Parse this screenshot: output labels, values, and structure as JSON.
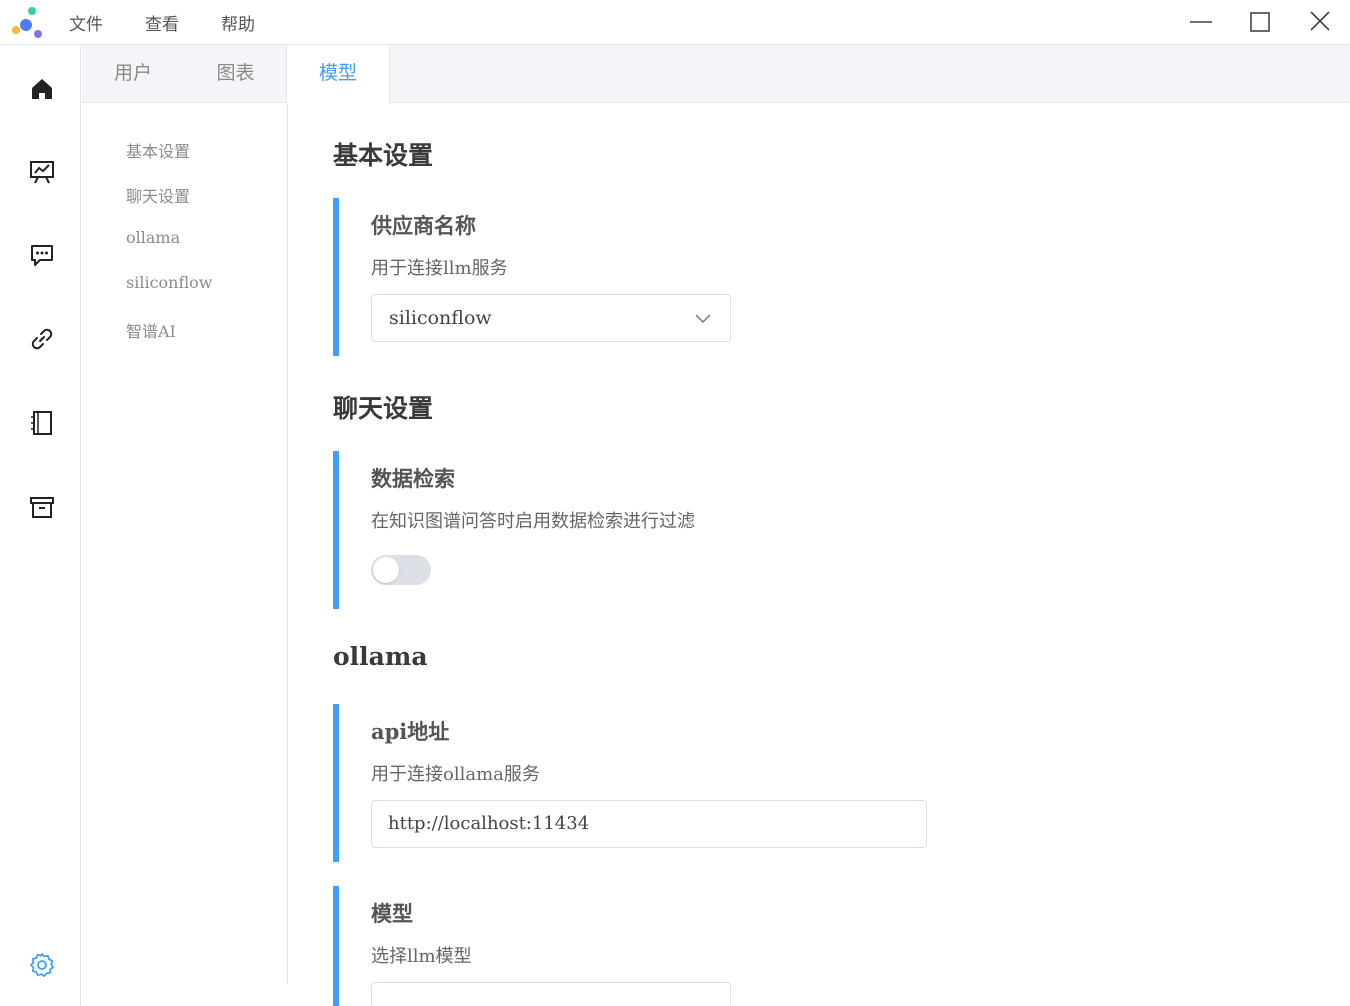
{
  "menubar": {
    "items": [
      "文件",
      "查看",
      "帮助"
    ]
  },
  "window_controls": [
    "minimize-icon",
    "maximize-icon",
    "close-icon"
  ],
  "rail": {
    "icons": [
      "home-icon",
      "chart-board-icon",
      "chat-icon",
      "link-icon",
      "notebook-icon",
      "archive-icon"
    ],
    "bottom_icon": "settings-icon"
  },
  "tabs": {
    "items": [
      "用户",
      "图表",
      "模型"
    ],
    "active": "模型"
  },
  "anchor_nav": {
    "items": [
      "基本设置",
      "聊天设置",
      "ollama",
      "siliconflow",
      "智谱AI"
    ]
  },
  "content": {
    "basic": {
      "title": "基本设置",
      "provider": {
        "title": "供应商名称",
        "desc": "用于连接llm服务",
        "value": "siliconflow"
      }
    },
    "chat": {
      "title": "聊天设置",
      "retrieval": {
        "title": "数据检索",
        "desc": "在知识图谱问答时启用数据检索进行过滤",
        "enabled": false
      }
    },
    "ollama": {
      "title": "ollama",
      "api": {
        "title": "api地址",
        "desc": "用于连接ollama服务",
        "value": "http://localhost:11434"
      },
      "model": {
        "title": "模型",
        "desc": "选择llm模型"
      }
    }
  },
  "colors": {
    "accent": "#409eff",
    "border": "#dcdfe6"
  }
}
